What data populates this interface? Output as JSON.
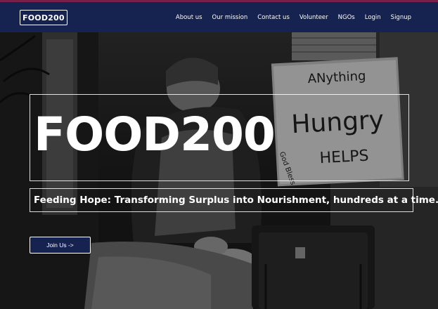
{
  "navbar": {
    "brand": "FOOD200",
    "links": [
      "About us",
      "Our mission",
      "Contact us",
      "Volunteer",
      "NGOs",
      "Login",
      "Signup"
    ]
  },
  "hero": {
    "title": "FOOD200",
    "tagline": "Feeding Hope: Transforming Surplus into Nourishment, hundreds at a time.",
    "join_button": "Join Us ->",
    "sign_text": {
      "line1": "ANything",
      "line2": "Hungry",
      "line3": "HELPS",
      "blessing": "God Bless"
    }
  },
  "colors": {
    "navbar_bg": "#16224f",
    "accent_strip": "#7a1f4a",
    "text": "#ffffff"
  }
}
